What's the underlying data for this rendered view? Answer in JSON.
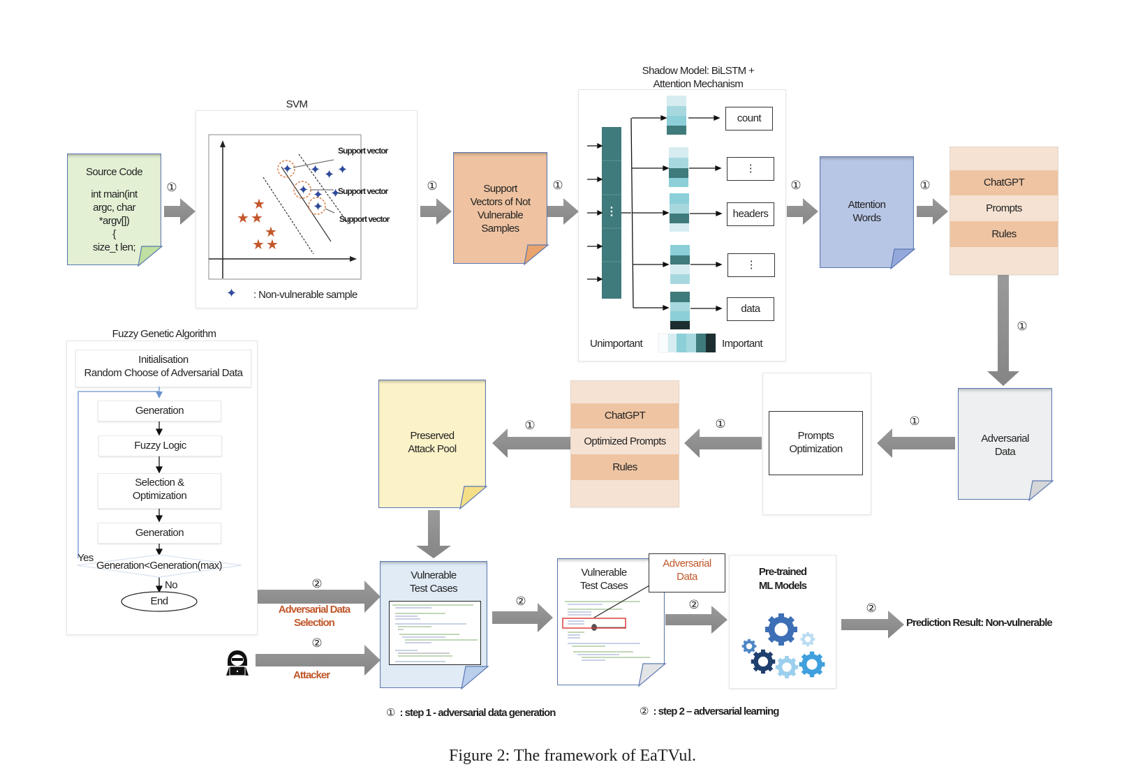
{
  "figure": {
    "caption": "Figure 2: The framework of EaTVul.",
    "colors": {
      "source_code_fill": "#e3f0d4",
      "support_vectors_fill": "#efc3a1",
      "attention_words_fill": "#b8c6e6",
      "chatgpt_stripe_dark": "#eec4a2",
      "chatgpt_stripe_light": "#f5e2d3",
      "adversarial_data_fill": "#eeeff0",
      "attack_pool_fill": "#fcf2c8",
      "test_cases_fill": "#e0ebf6",
      "arrow_gray": "#8c8c8c",
      "teal_dark": "#3f7a7c",
      "label_orange": "#c0572a"
    }
  },
  "source_code": {
    "title": "Source Code",
    "lines": [
      "int main(int",
      "argc, char",
      "*argv[])",
      "{",
      "size_t len;"
    ]
  },
  "svm": {
    "title": "SVM",
    "support_vector_labels": [
      "Support vector",
      "Support vector",
      "Support vector"
    ],
    "legend": ": Non-vulnerable sample"
  },
  "support_vectors_doc": {
    "label_lines": [
      "Support",
      "Vectors of Not",
      "Vulnerable",
      "Samples"
    ]
  },
  "shadow_model": {
    "title_lines": [
      "Shadow Model: BiLSTM +",
      "Attention Mechanism"
    ],
    "outputs": [
      "count",
      "⋮",
      "headers",
      "⋮",
      "data"
    ],
    "scale_low": "Unimportant",
    "scale_high": "Important",
    "lstm_ellipsis": "⋮"
  },
  "attention_words": {
    "label_lines": [
      "Attention",
      "Words"
    ]
  },
  "chatgpt_top": {
    "rows": [
      "ChatGPT",
      "Prompts",
      "Rules"
    ]
  },
  "adversarial_data_doc": {
    "label_lines": [
      "Adversarial",
      "Data"
    ]
  },
  "prompts_optimization": {
    "label_lines": [
      "Prompts",
      "Optimization"
    ]
  },
  "chatgpt_bottom": {
    "rows": [
      "ChatGPT",
      "Optimized Prompts",
      "Rules"
    ]
  },
  "attack_pool": {
    "label_lines": [
      "Preserved",
      "Attack Pool"
    ]
  },
  "fuzzy_ga": {
    "title": "Fuzzy Genetic Algorithm",
    "init_lines": [
      "Initialisation",
      "Random Choose of Adversarial Data"
    ],
    "steps": [
      "Generation",
      "Fuzzy Logic",
      "Selection &",
      "Optimization",
      "Generation"
    ],
    "condition": "Generation<Generation(max)",
    "yes_label": "Yes",
    "no_label": "No",
    "end_label": "End"
  },
  "step2_inputs": {
    "adversarial_selection_lines": [
      "Adversarial Data",
      "Selection"
    ],
    "attacker_label": "Attacker"
  },
  "test_cases_1": {
    "label_lines": [
      "Vulnerable",
      "Test Cases"
    ]
  },
  "test_cases_2": {
    "label_lines": [
      "Vulnerable",
      "Test Cases"
    ],
    "callout_lines": [
      "Adversarial",
      "Data"
    ]
  },
  "ml_models": {
    "label_lines": [
      "Pre-trained",
      "ML Models"
    ]
  },
  "prediction": "Prediction Result: Non-vulnerable",
  "step_marks": {
    "one": "①",
    "two": "②"
  },
  "legend": {
    "step1": ": step 1 - adversarial data generation",
    "step2": ": step 2 – adversarial learning"
  }
}
